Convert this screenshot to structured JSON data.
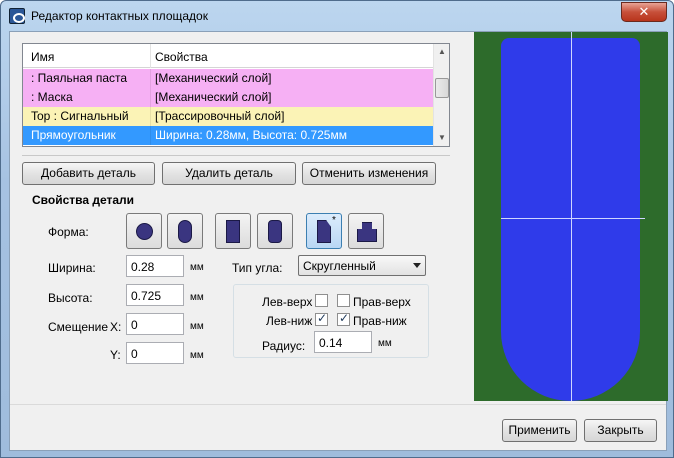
{
  "window": {
    "title": "Редактор контактных площадок",
    "close_glyph": "✕"
  },
  "list": {
    "columns": [
      "Имя",
      "Свойства"
    ],
    "rows": [
      {
        "name": " : Паяльная паста",
        "props": "[Механический слой]",
        "bg": "#f6b0f4"
      },
      {
        "name": " : Маска",
        "props": "[Механический слой]",
        "bg": "#f6b0f4"
      },
      {
        "name": "Top : Сигнальный",
        "props": "[Трассировочный слой]",
        "bg": "#fbf3b6"
      },
      {
        "name": "    Прямоугольник",
        "props": "Ширина: 0.28мм, Высота: 0.725мм",
        "bg": "#3399ff",
        "selected": true
      }
    ]
  },
  "buttons": {
    "add": "Добавить деталь",
    "remove": "Удалить деталь",
    "revert": "Отменить изменения",
    "apply": "Применить",
    "close": "Закрыть"
  },
  "details": {
    "title": "Свойства детали",
    "shape_label": "Форма:",
    "shapes": [
      "circle-icon",
      "oval-icon",
      "rectangle-icon",
      "rounded-rectangle-icon",
      "custom-corner-icon",
      "notched-rectangle-icon"
    ],
    "selected_shape": "custom-corner-icon",
    "width_label": "Ширина:",
    "width_value": "0.28",
    "height_label": "Высота:",
    "height_value": "0.725",
    "offset_label": "Смещение",
    "x_label": "X:",
    "x_value": "0",
    "y_label": "Y:",
    "y_value": "0",
    "unit": "мм",
    "corner_type_label": "Тип угла:",
    "corner_type_value": "Скругленный",
    "corners": {
      "top_left": {
        "label": "Лев-верх",
        "checked": false
      },
      "top_right": {
        "label": "Прав-верх",
        "checked": false
      },
      "bottom_left": {
        "label": "Лев-ниж",
        "checked": true
      },
      "bottom_right": {
        "label": "Прав-ниж",
        "checked": true
      }
    },
    "radius_label": "Радиус:",
    "radius_value": "0.14"
  },
  "colors": {
    "preview_bg": "#2d6b2b",
    "pad": "#2f3bea",
    "selection": "#3399ff"
  }
}
